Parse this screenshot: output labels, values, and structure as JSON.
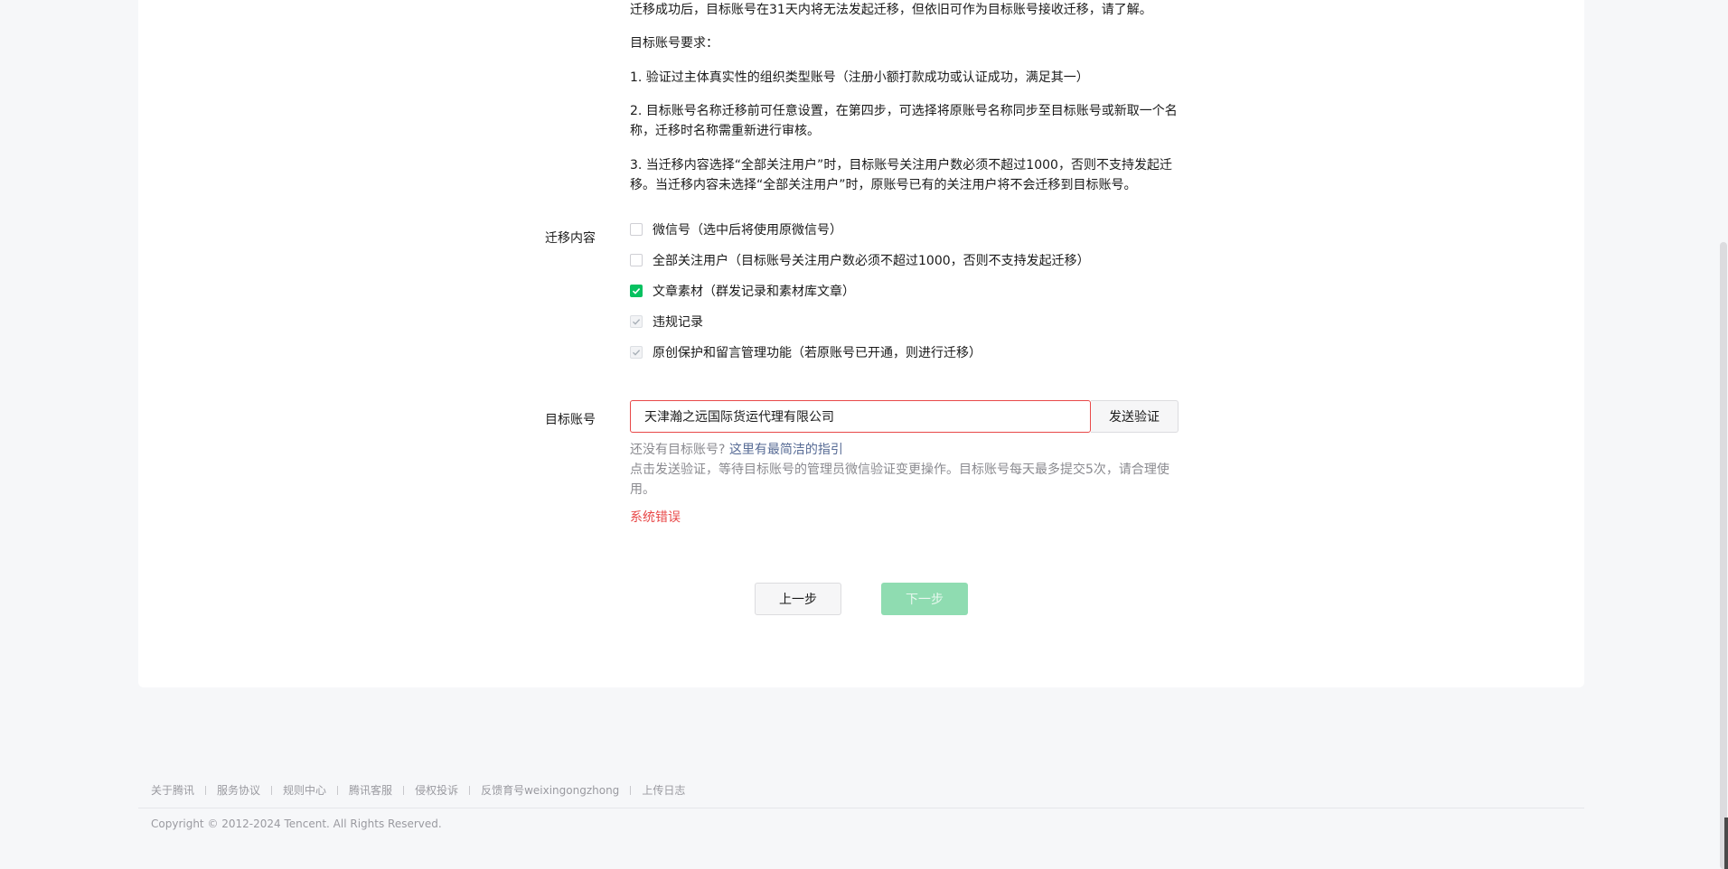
{
  "intro": {
    "line1": "迁移成功后，目标账号在31天内将无法发起迁移，但依旧可作为目标账号接收迁移，请了解。",
    "req_title": "目标账号要求：",
    "req1": "1. 验证过主体真实性的组织类型账号（注册小额打款成功或认证成功，满足其一）",
    "req2": "2. 目标账号名称迁移前可任意设置，在第四步，可选择将原账号名称同步至目标账号或新取一个名称，迁移时名称需重新进行审核。",
    "req3": "3. 当迁移内容选择“全部关注用户”时，目标账号关注用户数必须不超过1000，否则不支持发起迁移。当迁移内容未选择“全部关注用户”时，原账号已有的关注用户将不会迁移到目标账号。"
  },
  "migrate_content": {
    "label": "迁移内容",
    "options": [
      {
        "label": "微信号（选中后将使用原微信号）",
        "state": "unchecked"
      },
      {
        "label": "全部关注用户（目标账号关注用户数必须不超过1000，否则不支持发起迁移）",
        "state": "unchecked"
      },
      {
        "label": "文章素材（群发记录和素材库文章）",
        "state": "checked"
      },
      {
        "label": "违规记录",
        "state": "disabled-checked"
      },
      {
        "label": "原创保护和留言管理功能（若原账号已开通，则进行迁移）",
        "state": "disabled-checked"
      }
    ]
  },
  "target_account": {
    "label": "目标账号",
    "value": "天津瀚之远国际货运代理有限公司",
    "send_verify": "发送验证",
    "no_account_text": "还没有目标账号?",
    "guide_link": "这里有最简洁的指引",
    "hint": "点击发送验证，等待目标账号的管理员微信验证变更操作。目标账号每天最多提交5次，请合理使用。",
    "error": "系统错误"
  },
  "buttons": {
    "prev": "上一步",
    "next": "下一步"
  },
  "footer": {
    "links": [
      "关于腾讯",
      "服务协议",
      "规则中心",
      "腾讯客服",
      "侵权投诉",
      "反馈育号weixingongzhong",
      "上传日志"
    ],
    "copyright": "Copyright © 2012-2024 Tencent. All Rights Reserved."
  },
  "colors": {
    "accent": "#07c160",
    "error": "#e84848",
    "link": "#576b95"
  }
}
